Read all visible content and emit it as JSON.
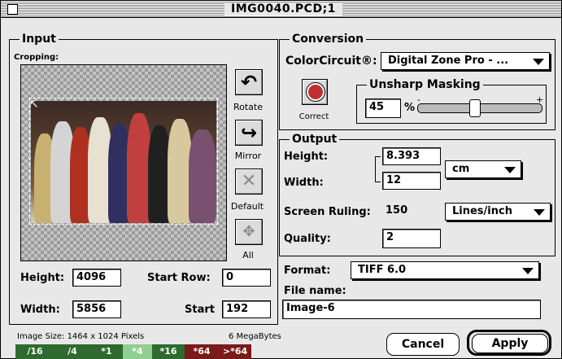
{
  "window": {
    "title": "IMG0040.PCD;1"
  },
  "input": {
    "group_label": "Input",
    "cropping_label": "Cropping:",
    "tools": [
      {
        "label": "Rotate",
        "icon": "rotate-icon"
      },
      {
        "label": "Mirror",
        "icon": "mirror-icon"
      },
      {
        "label": "Default",
        "icon": "default-icon"
      },
      {
        "label": "All",
        "icon": "all-icon"
      }
    ],
    "height_label": "Height:",
    "height_value": "4096",
    "width_label": "Width:",
    "width_value": "5856",
    "start_row_label": "Start Row:",
    "start_row_value": "0",
    "start_col_label": "Start",
    "start_col_value": "192"
  },
  "conversion": {
    "group_label": "Conversion",
    "colorcircuit_label": "ColorCircuit®:",
    "colorcircuit_value": "Digital Zone Pro - ...",
    "correct_label": "Correct",
    "unsharp_label": "Unsharp Masking",
    "unsharp_value": "45",
    "unsharp_unit": "%",
    "slider_minus": "-",
    "slider_plus": "+",
    "slider_level": 0.45
  },
  "output": {
    "group_label": "Output",
    "height_label": "Height:",
    "height_value": "8.393",
    "width_label": "Width:",
    "width_value": "12",
    "unit_value": "cm",
    "screen_ruling_label": "Screen Ruling:",
    "screen_ruling_value": "150",
    "ruling_unit_value": "Lines/inch",
    "quality_label": "Quality:",
    "quality_value": "2"
  },
  "format": {
    "label": "Format:",
    "value": "TIFF 6.0",
    "filename_label": "File name:",
    "filename_value": "Image-6"
  },
  "status": {
    "image_size": "Image Size: 1464 x 1024  Pixels",
    "megabytes": "6  MegaBytes"
  },
  "memory_bar": [
    {
      "label": "/16",
      "color": "#2f6a2f"
    },
    {
      "label": "/4",
      "color": "#2f6a2f"
    },
    {
      "label": "*1",
      "color": "#2f6a2f"
    },
    {
      "label": "*4",
      "color": "#8fcf8f"
    },
    {
      "label": "*16",
      "color": "#2f6a2f"
    },
    {
      "label": "*64",
      "color": "#7a1a1a"
    },
    {
      "label": ">*64",
      "color": "#7a1a1a"
    }
  ],
  "buttons": {
    "cancel": "Cancel",
    "apply": "Apply"
  }
}
